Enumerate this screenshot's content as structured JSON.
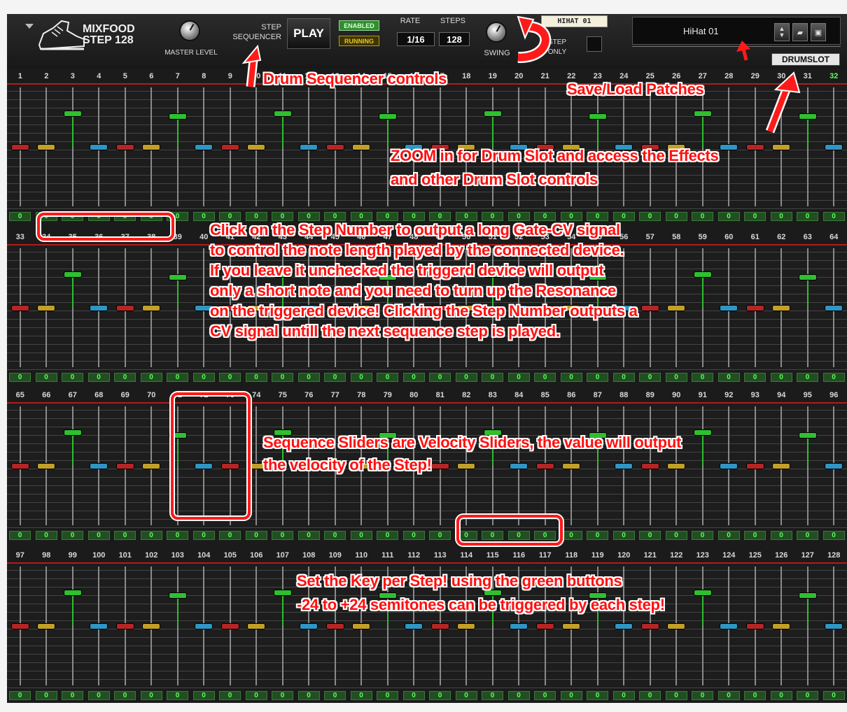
{
  "app": {
    "brand_line1": "MIXFOOD",
    "brand_line2": "STEP 128",
    "master_level_label": "MASTER LEVEL",
    "step_sequencer_label_1": "STEP",
    "step_sequencer_label_2": "SEQUENCER",
    "play_label": "PLAY",
    "enabled_label": "ENABLED",
    "running_label": "RUNNING",
    "rate_label": "RATE",
    "steps_label": "STEPS",
    "rate_value": "1/16",
    "steps_value": "128",
    "swing_label": "SWING",
    "step_only_label_1": "STEP",
    "step_only_label_2": "ONLY",
    "instrument_tag": "HIHAT 01",
    "patch_name": "HiHat 01",
    "drumslot_label": "DRUMSLOT"
  },
  "colors": {
    "red_handle": "#b52525",
    "yellow_handle": "#c2a028",
    "blue_handle": "#2f95c4",
    "green_handle": "#2fbf2f",
    "annotation": "#ff1010"
  },
  "key_button_value": "0",
  "rows": [
    {
      "start": 1,
      "highlight_last": true
    },
    {
      "start": 33,
      "highlight_last": false
    },
    {
      "start": 65,
      "highlight_last": false
    },
    {
      "start": 97,
      "highlight_last": false
    }
  ],
  "slider_pattern": [
    {
      "color": "red",
      "level": 0.5
    },
    {
      "color": "yellow",
      "level": 0.5
    },
    {
      "color": "green",
      "level": 0.78
    },
    {
      "color": "blue",
      "level": 0.5
    },
    {
      "color": "red",
      "level": 0.5
    },
    {
      "color": "yellow",
      "level": 0.5
    },
    {
      "color": "green",
      "level": 0.76
    },
    {
      "color": "blue",
      "level": 0.5
    }
  ],
  "annotations": {
    "drum_sequencer": "Drum Sequencer controls",
    "save_load": "Save/Load Patches",
    "zoom_line1": "ZOOM in for Drum Slot and access the Effects",
    "zoom_line2": "and other  Drum Slot controls",
    "step_number_lines": [
      "Click on the Step Number to output a long Gate-CV signal",
      "to control the note length played by the connected device.",
      "If you leave it unchecked the triggerd device will output",
      "only a short note and you need to turn up the Resonance",
      "on the triggered device! Clicking the Step Number outputs a",
      "CV signal untill the next sequence step is played."
    ],
    "velocity_line1": "Sequence Sliders are Velocity Sliders, the value will output",
    "velocity_line2": "the velocity of the Step!",
    "key_line1": "Set the Key per Step! using the green buttons",
    "key_line2": "-24 to +24 semitones can be triggered by each step!"
  }
}
